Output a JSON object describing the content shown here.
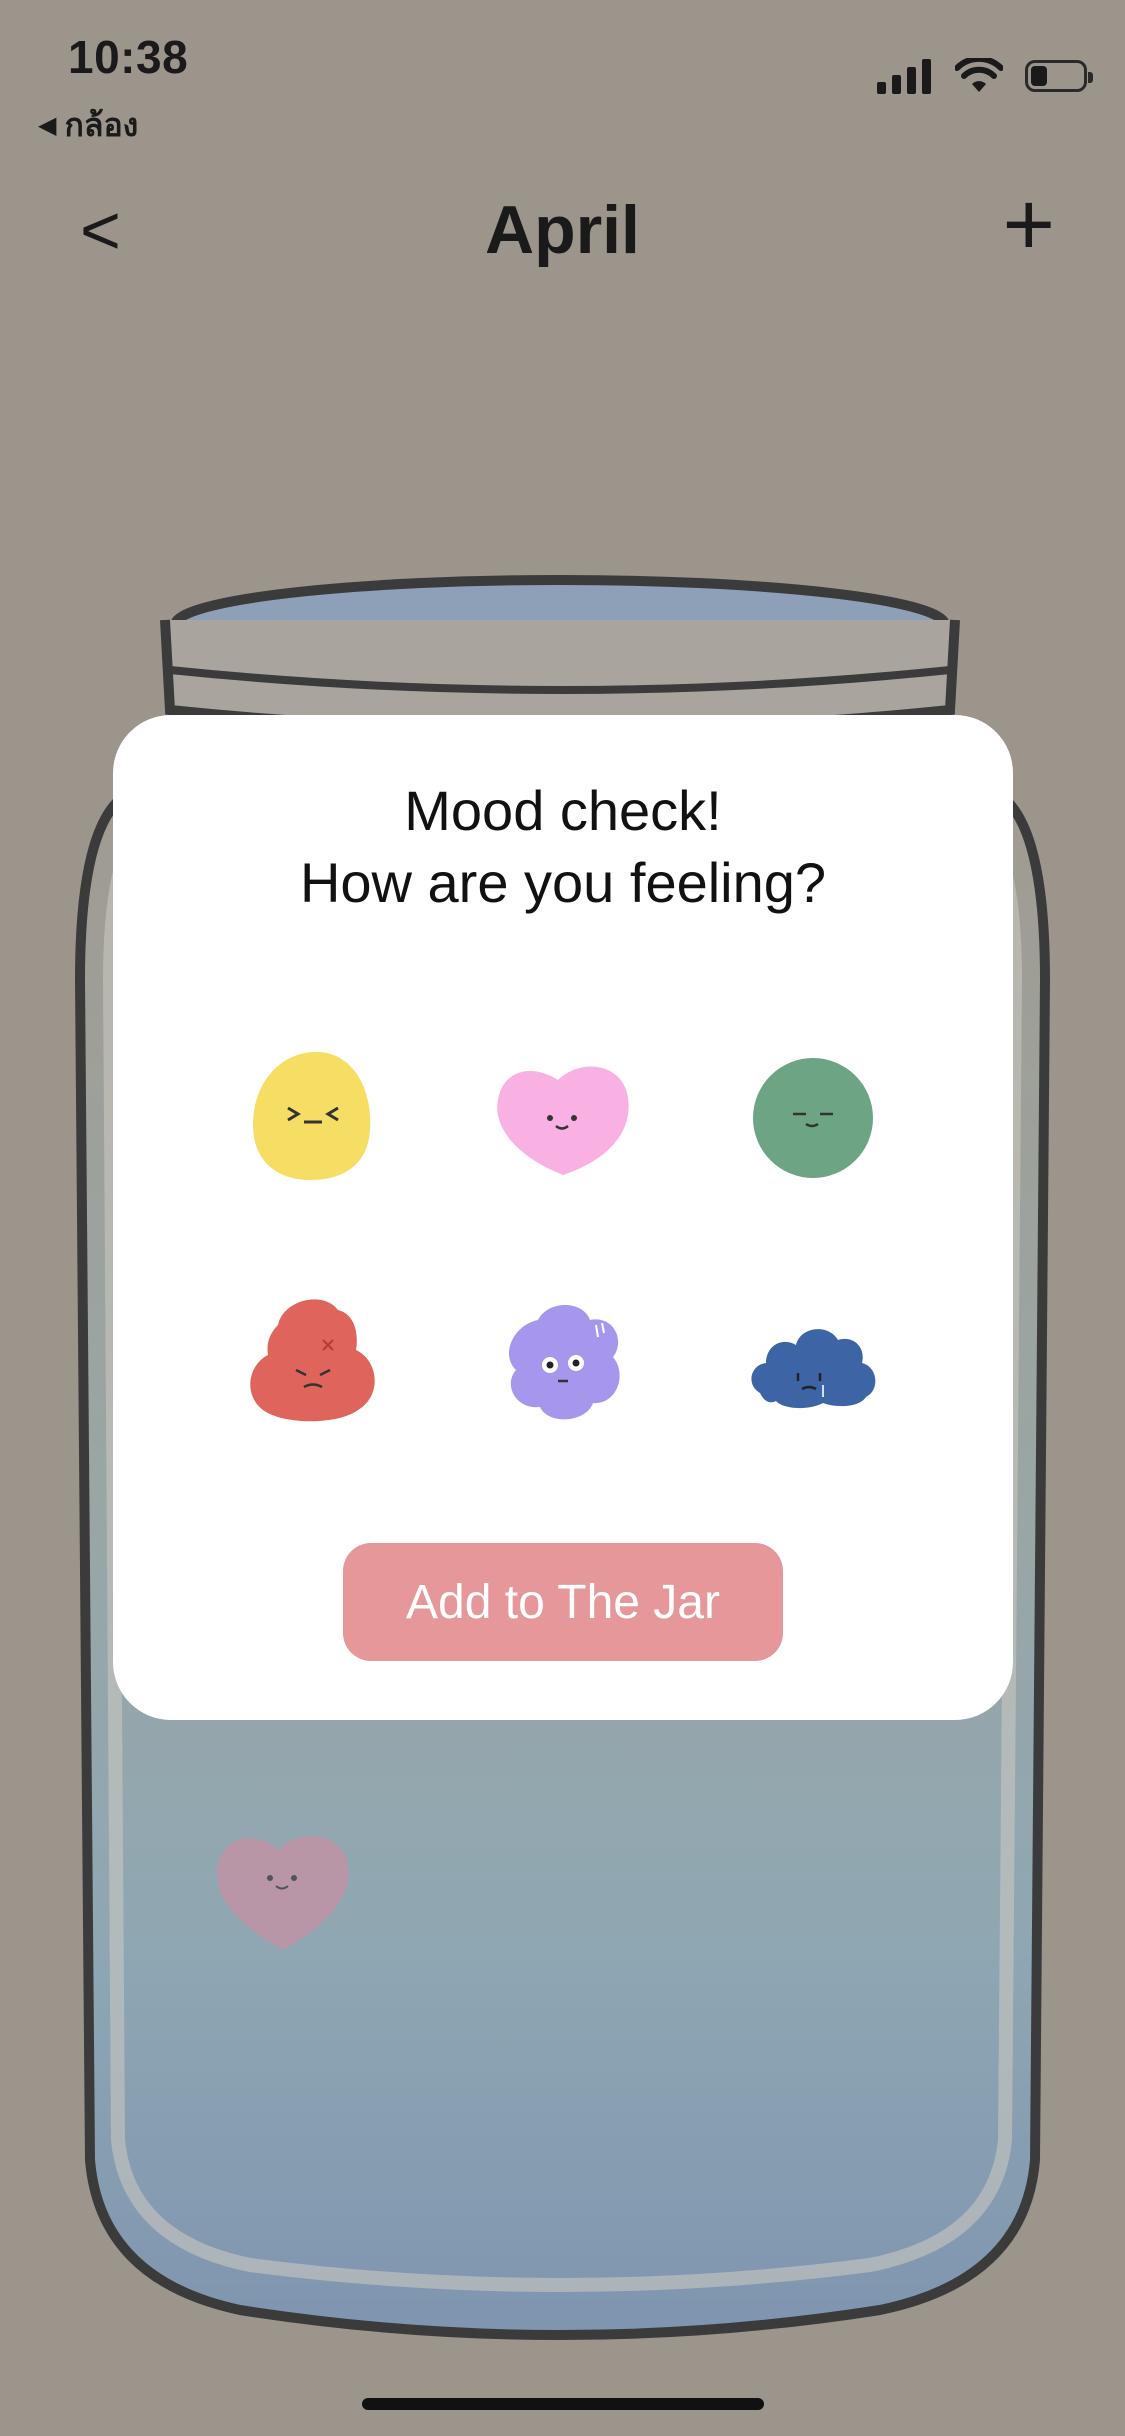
{
  "colors": {
    "background": "#9b958c",
    "button": "#e5979a",
    "modal": "#ffffff"
  },
  "status_bar": {
    "time": "10:38",
    "back_app_label": "กล้อง",
    "back_arrow_icon": "triangle-left-icon",
    "icons": [
      "cellular-signal-icon",
      "wifi-icon",
      "battery-icon"
    ]
  },
  "nav": {
    "back_label": "<",
    "title": "April",
    "add_label": "+"
  },
  "dialog": {
    "title_line1": "Mood check!",
    "title_line2": "How are you feeling?",
    "moods": [
      {
        "name": "happy-yellow-mood-icon",
        "color": "#f6dd63"
      },
      {
        "name": "love-pink-heart-mood-icon",
        "color": "#f8b1e2"
      },
      {
        "name": "calm-green-mood-icon",
        "color": "#6da584"
      },
      {
        "name": "angry-red-mood-icon",
        "color": "#df645c"
      },
      {
        "name": "anxious-purple-mood-icon",
        "color": "#a696ec"
      },
      {
        "name": "sad-blue-cloud-mood-icon",
        "color": "#3d64a5"
      }
    ],
    "button_label": "Add to The Jar"
  }
}
